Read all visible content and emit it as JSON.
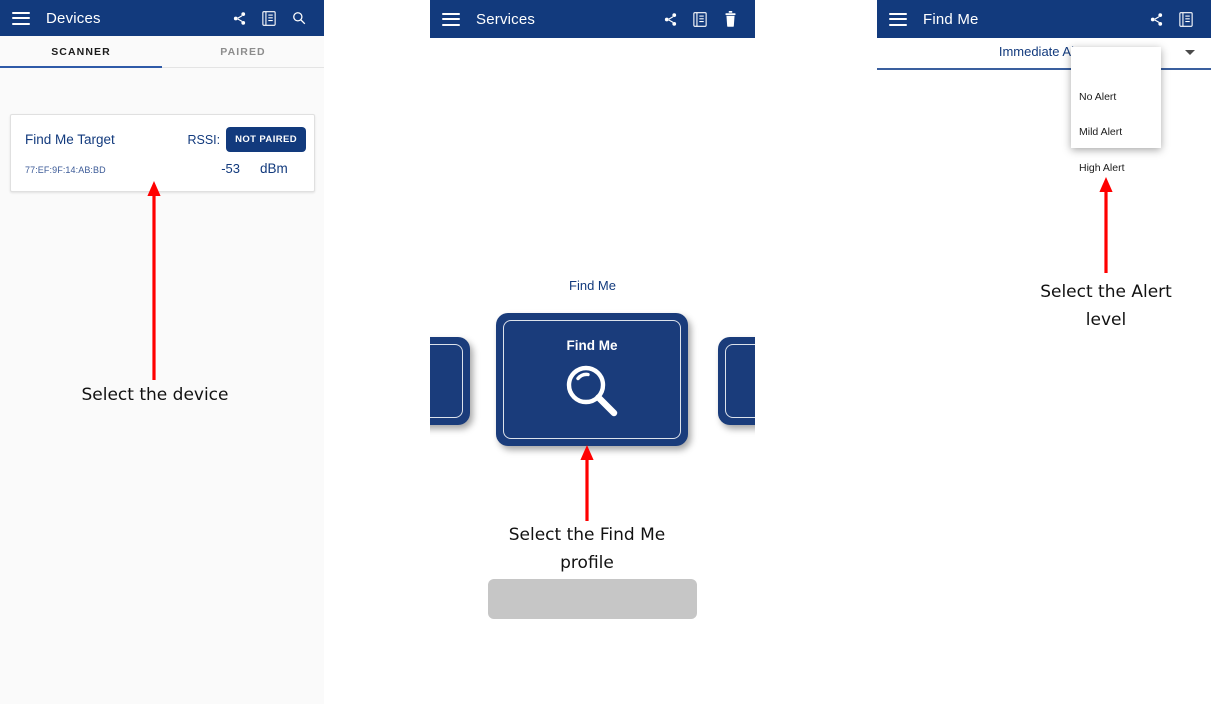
{
  "panels": {
    "devices": {
      "appbar": {
        "title": "Devices",
        "menu_icon": "hamburger-icon",
        "actions": [
          {
            "name": "share-icon",
            "label": "Share"
          },
          {
            "name": "log-icon",
            "label": "Log"
          },
          {
            "name": "search-icon",
            "label": "Search"
          }
        ]
      },
      "tabs": [
        {
          "label": "SCANNER",
          "active": true
        },
        {
          "label": "PAIRED",
          "active": false
        }
      ],
      "device": {
        "name": "Find Me Target",
        "mac": "77:EF:9F:14:AB:BD",
        "rssi_label": "RSSI:",
        "rssi_value": "-53",
        "rssi_unit": "dBm",
        "pair_state": "NOT PAIRED"
      }
    },
    "services": {
      "appbar": {
        "title": "Services",
        "menu_icon": "hamburger-icon",
        "actions": [
          {
            "name": "share-icon",
            "label": "Share"
          },
          {
            "name": "log-icon",
            "label": "Log"
          },
          {
            "name": "trash-icon",
            "label": "Delete"
          }
        ]
      },
      "section_title": "Find Me",
      "cards": [
        {
          "label": "",
          "icon": "profile-card-partial-left"
        },
        {
          "label": "Find Me",
          "icon": "magnifier-icon"
        },
        {
          "label": "",
          "icon": "profile-card-partial-right"
        }
      ],
      "bottom_bar": ""
    },
    "findme": {
      "appbar": {
        "title": "Find Me",
        "menu_icon": "hamburger-icon",
        "actions": [
          {
            "name": "share-icon",
            "label": "Share"
          },
          {
            "name": "log-icon",
            "label": "Log"
          }
        ]
      },
      "selector": {
        "label": "Immediate Alert",
        "caret": "chevron-down-icon"
      },
      "dropdown_options": [
        {
          "label": "No Alert"
        },
        {
          "label": "Mild Alert"
        },
        {
          "label": "High Alert"
        }
      ]
    }
  },
  "annotations": [
    {
      "id": "a1",
      "text": "Select the device"
    },
    {
      "id": "a2",
      "text": "Select the Find Me\nprofile"
    },
    {
      "id": "a3",
      "text": "Select the Alert\nlevel"
    }
  ],
  "colors": {
    "appbar_blue": "#123a7d",
    "card_blue": "#1a3c7b",
    "accent_blue": "#2f5aa8",
    "arrow_red": "#ff0000",
    "panel_bg": "#fafafa",
    "gray_bar": "#c6c6c6"
  }
}
